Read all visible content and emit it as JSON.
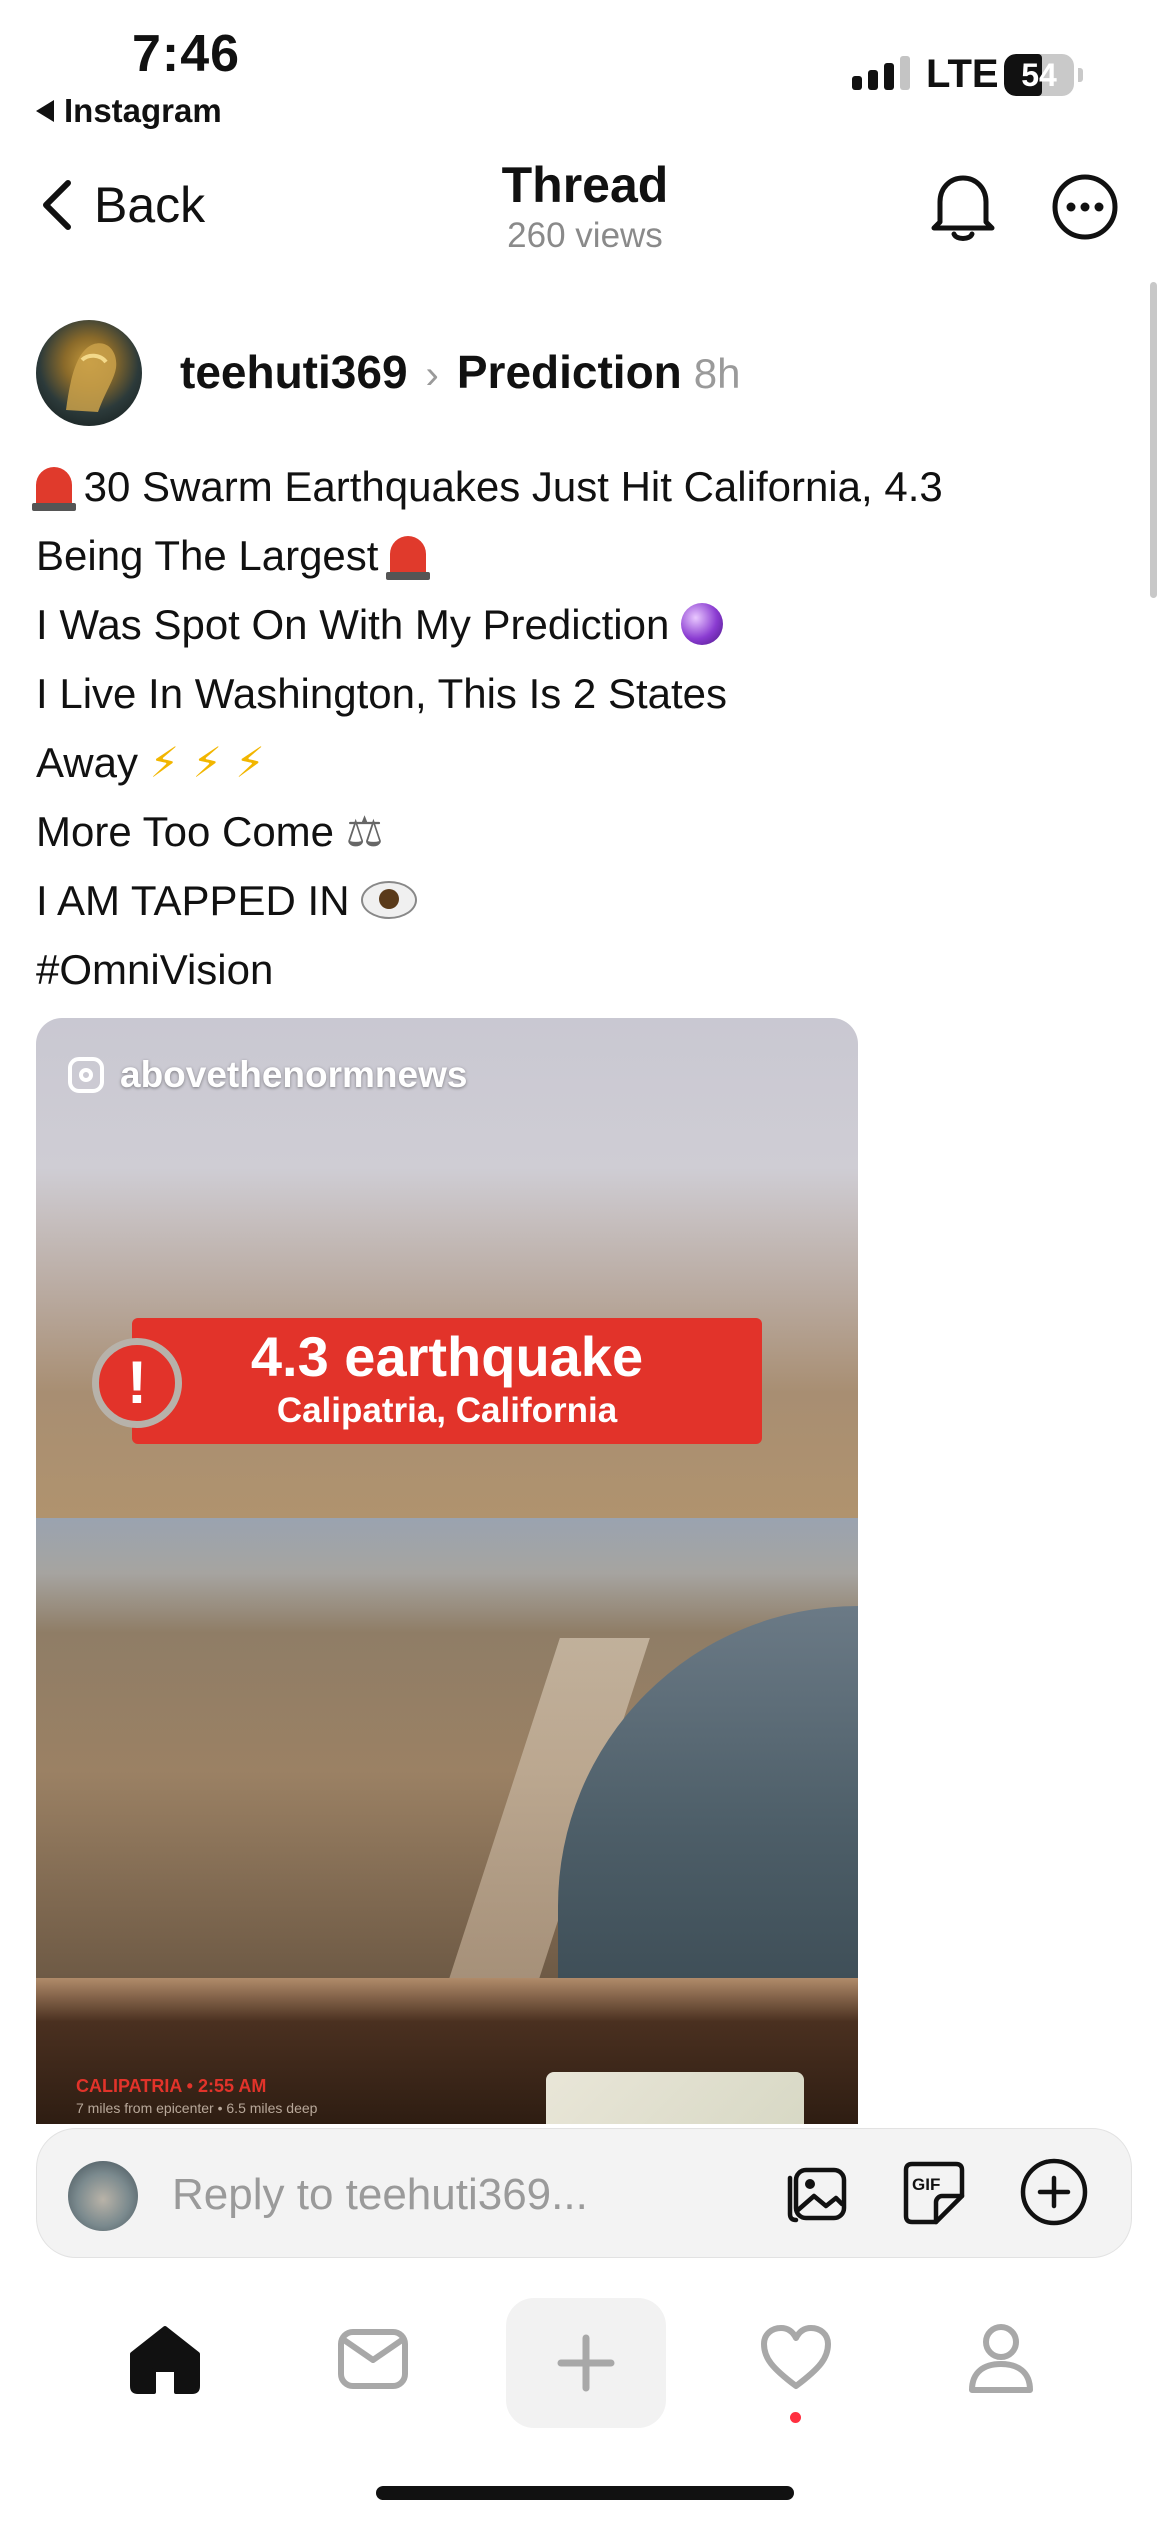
{
  "status_bar": {
    "time": "7:46",
    "back_app": "Instagram",
    "network": "LTE",
    "battery": "54",
    "battery_level": 0.54
  },
  "nav": {
    "back_label": "Back",
    "title": "Thread",
    "views": "260 views"
  },
  "post": {
    "username": "teehuti369",
    "topic": "Prediction",
    "time_ago": "8h",
    "lines": [
      "30 Swarm Earthquakes Just Hit California, 4.3",
      "Being The Largest",
      "I Was Spot On With My Prediction",
      "I Live In Washington, This Is 2 States",
      "Away",
      "More Too Come",
      "I AM TAPPED IN",
      "#OmniVision"
    ],
    "media": {
      "source_handle": "abovethenormnews",
      "headline": "4.3 earthquake",
      "location": "Calipatria, California",
      "caption_title": "CALIPATRIA • 2:55 AM",
      "caption_sub": "7 miles from epicenter • 6.5 miles deep"
    }
  },
  "reply": {
    "placeholder": "Reply to teehuti369..."
  },
  "tabbar": {
    "items": [
      "home-icon",
      "inbox-icon",
      "create-icon",
      "activity-icon",
      "profile-icon"
    ],
    "activity_has_notification": true
  },
  "colors": {
    "alert_red": "#e2332a",
    "notification_dot": "#ff3040",
    "muted_text": "#9a9a9a",
    "lightning": "#f2b600"
  }
}
